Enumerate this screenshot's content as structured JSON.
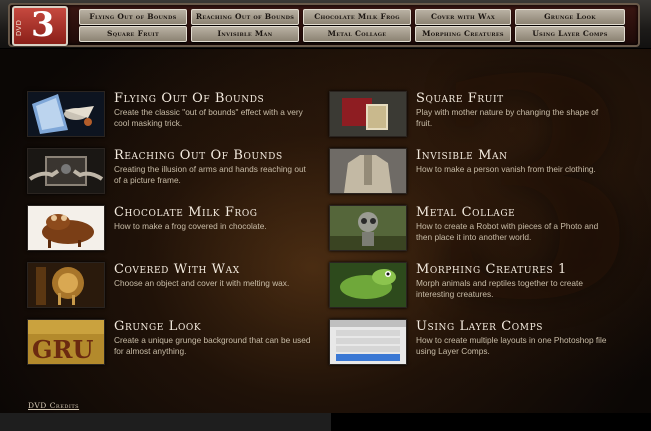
{
  "dvd": {
    "label": "DVD",
    "number": "3"
  },
  "nav": {
    "row1": [
      "Flying Out of Bounds",
      "Reaching Out of Bounds",
      "Chocolate Milk Frog",
      "Cover with Wax",
      "Grunge Look"
    ],
    "row2": [
      "Square Fruit",
      "Invisible Man",
      "Metal Collage",
      "Morphing Creatures",
      "Using Layer Comps"
    ]
  },
  "items": [
    {
      "title": "Flying Out Of Bounds",
      "desc": "Create the classic \"out of bounds\" effect with a very cool masking trick."
    },
    {
      "title": "Reaching Out Of Bounds",
      "desc": "Creating the illusion of arms and hands reaching out of a picture frame."
    },
    {
      "title": "Chocolate Milk Frog",
      "desc": "How to make a frog covered in chocolate."
    },
    {
      "title": "Covered With Wax",
      "desc": "Choose an object and cover it with melting wax."
    },
    {
      "title": "Grunge Look",
      "desc": "Create a unique grunge background that can be used for almost anything."
    },
    {
      "title": "Square Fruit",
      "desc": "Play with mother nature by changing the shape of fruit."
    },
    {
      "title": "Invisible Man",
      "desc": "How to make a person vanish from their clothing."
    },
    {
      "title": "Metal Collage",
      "desc": "How to create a Robot with pieces of a Photo and then place it into another world."
    },
    {
      "title": "Morphing Creatures 1",
      "desc": "Morph animals and reptiles together to create interesting creatures."
    },
    {
      "title": "Using Layer Comps",
      "desc": "How to create multiple layouts in one Photoshop file using Layer Comps."
    }
  ],
  "credits": "DVD Credits"
}
